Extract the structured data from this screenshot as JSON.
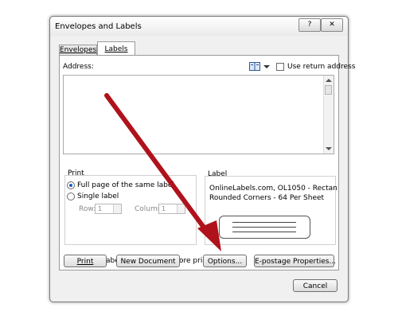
{
  "dialog": {
    "title": "Envelopes and Labels",
    "help_glyph": "?",
    "close_glyph": "✕"
  },
  "tabs": [
    {
      "label": "Envelopes",
      "selected": false
    },
    {
      "label": "Labels",
      "selected": true
    }
  ],
  "address": {
    "label": "Address:",
    "value": "",
    "book_icon": "address-book-icon",
    "use_return_address": {
      "label": "Use return address",
      "checked": false
    }
  },
  "print": {
    "label": "Print",
    "options": [
      {
        "label": "Full page of the same label",
        "selected": true
      },
      {
        "label": "Single label",
        "selected": false
      }
    ],
    "row_label": "Row:",
    "row_value": "1",
    "column_label": "Column:",
    "column_value": "1"
  },
  "label": {
    "caption": "Label",
    "line1": "OnlineLabels.com, OL1050 - Rectan",
    "line2": "Rounded Corners - 64 Per Sheet"
  },
  "verify_text": "Verify that labels are loaded before printing.",
  "buttons": {
    "print": "Print",
    "new_document": "New Document",
    "options": "Options...",
    "epostage": "E-postage Properties...",
    "cancel": "Cancel"
  },
  "colors": {
    "annotation_arrow": "#b0121b",
    "radio_selected": "#1a5fc4"
  }
}
